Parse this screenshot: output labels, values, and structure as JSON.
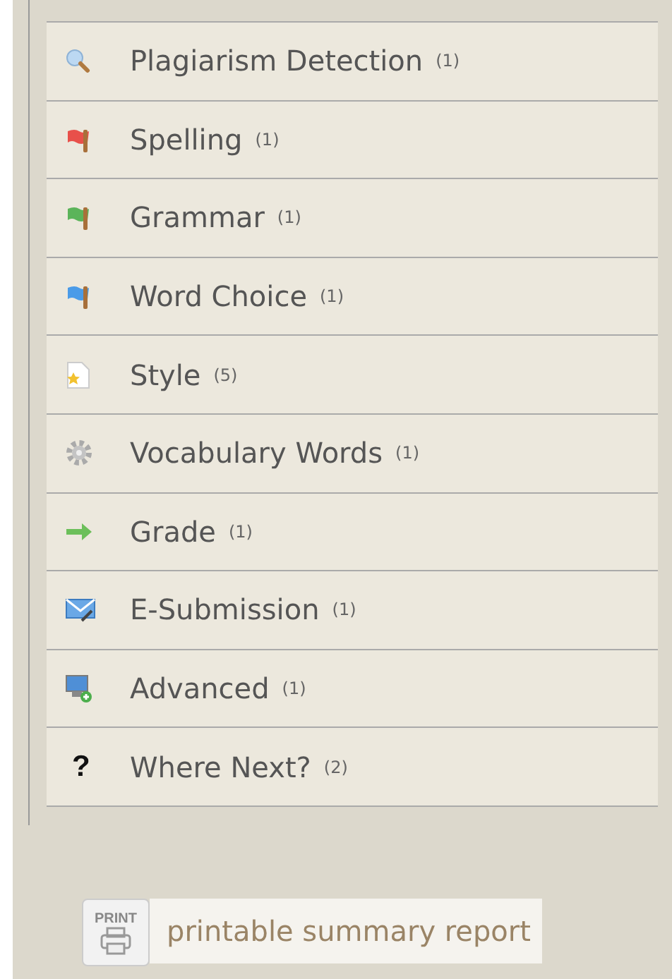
{
  "items": [
    {
      "kind": "search",
      "label": "Plagiarism Detection",
      "count": "(1)"
    },
    {
      "kind": "flag",
      "color": "#e8504a",
      "label": "Spelling",
      "count": "(1)"
    },
    {
      "kind": "flag",
      "color": "#5bb45a",
      "label": "Grammar",
      "count": "(1)"
    },
    {
      "kind": "flag",
      "color": "#4a9be8",
      "label": "Word Choice",
      "count": "(1)"
    },
    {
      "kind": "document",
      "label": "Style",
      "count": "(5)"
    },
    {
      "kind": "gear",
      "label": "Vocabulary Words",
      "count": "(1)"
    },
    {
      "kind": "arrow",
      "label": "Grade",
      "count": "(1)"
    },
    {
      "kind": "mail",
      "label": "E-Submission",
      "count": "(1)"
    },
    {
      "kind": "monitor",
      "label": "Advanced",
      "count": "(1)"
    },
    {
      "kind": "glyph",
      "glyph": "?",
      "label": "Where Next?",
      "count": "(2)"
    }
  ],
  "print": {
    "icon_label": "PRINT",
    "label": "printable summary report"
  }
}
